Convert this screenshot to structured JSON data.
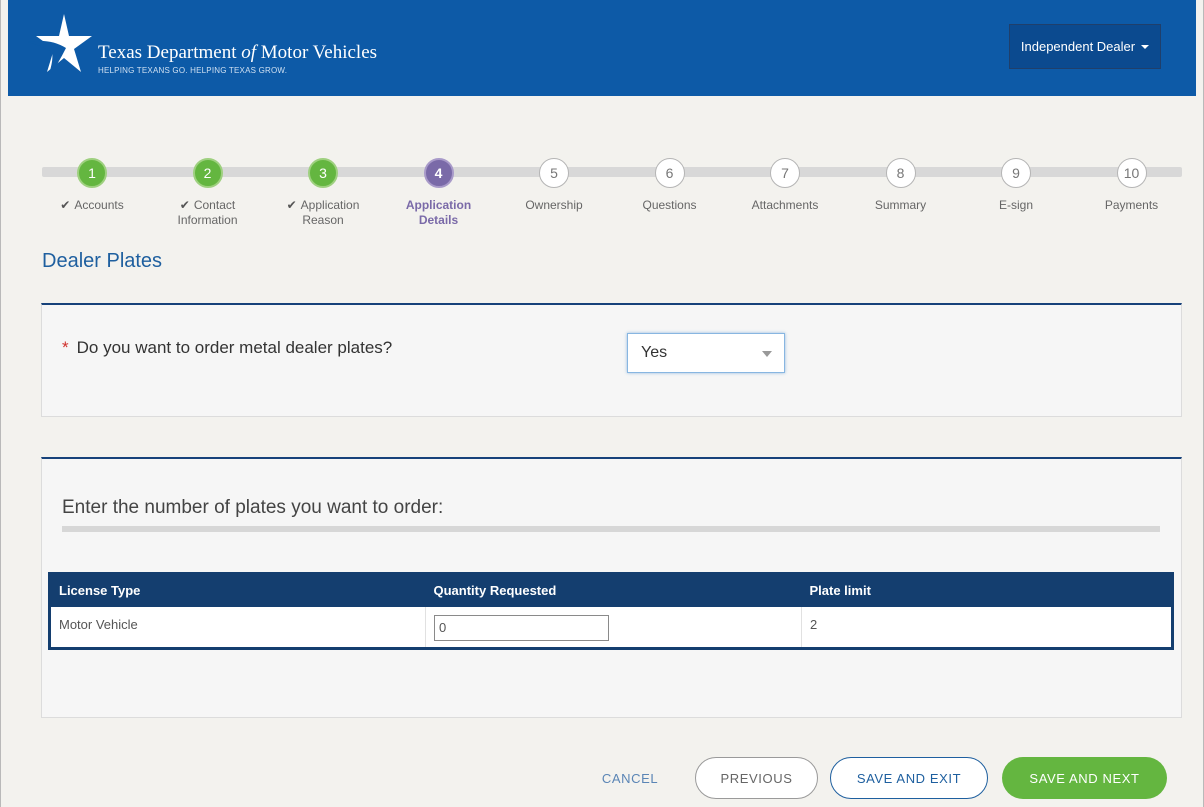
{
  "header": {
    "title_pre": "Texas Department ",
    "title_of": "of",
    "title_post": " Motor Vehicles",
    "tagline": "HELPING TEXANS GO. HELPING TEXAS GROW.",
    "account_menu": "Independent Dealer"
  },
  "stepper": {
    "steps": [
      {
        "number": "1",
        "label_l1": "Accounts",
        "label_l2": "",
        "state": "done"
      },
      {
        "number": "2",
        "label_l1": "Contact",
        "label_l2": "Information",
        "state": "done"
      },
      {
        "number": "3",
        "label_l1": "Application",
        "label_l2": "Reason",
        "state": "done"
      },
      {
        "number": "4",
        "label_l1": "Application",
        "label_l2": "Details",
        "state": "active"
      },
      {
        "number": "5",
        "label_l1": "Ownership",
        "label_l2": "",
        "state": "todo"
      },
      {
        "number": "6",
        "label_l1": "Questions",
        "label_l2": "",
        "state": "todo"
      },
      {
        "number": "7",
        "label_l1": "Attachments",
        "label_l2": "",
        "state": "todo"
      },
      {
        "number": "8",
        "label_l1": "Summary",
        "label_l2": "",
        "state": "todo"
      },
      {
        "number": "9",
        "label_l1": "E-sign",
        "label_l2": "",
        "state": "todo"
      },
      {
        "number": "10",
        "label_l1": "Payments",
        "label_l2": "",
        "state": "todo"
      }
    ]
  },
  "section": {
    "title": "Dealer Plates"
  },
  "question": {
    "required_mark": "*",
    "text": "Do you want to order metal dealer plates?",
    "selected_value": "Yes"
  },
  "plates": {
    "instruction": "Enter the number of plates you want to order:",
    "columns": [
      "License Type",
      "Quantity Requested",
      "Plate limit"
    ],
    "rows": [
      {
        "license_type": "Motor Vehicle",
        "quantity": "0",
        "limit": "2"
      }
    ]
  },
  "footer": {
    "cancel": "CANCEL",
    "previous": "PREVIOUS",
    "save_exit": "SAVE AND EXIT",
    "save_next": "SAVE AND NEXT"
  },
  "colors": {
    "header_blue": "#0d5aa7",
    "done_green": "#64b640",
    "active_purple": "#7a6aa8",
    "table_navy": "#143e6f"
  }
}
